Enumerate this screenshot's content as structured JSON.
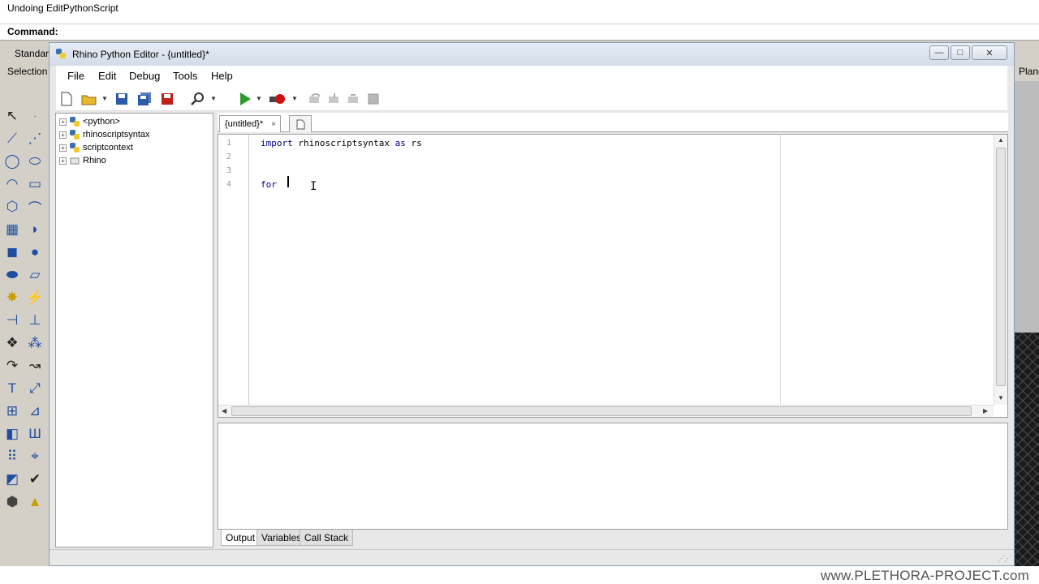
{
  "rhino": {
    "history_text": "Undoing EditPythonScript",
    "command_label": "Command:",
    "tabs_left": [
      "Standard",
      "Selection"
    ],
    "tab_right": "Plane",
    "footer_watermark": "www.PLETHORA-PROJECT.com"
  },
  "editor": {
    "title": "Rhino Python Editor - {untitled}*",
    "window_buttons": {
      "minimize": "—",
      "maximize": "□",
      "close": "✕"
    },
    "menu": [
      "File",
      "Edit",
      "Debug",
      "Tools",
      "Help"
    ],
    "tree": [
      "<python>",
      "rhinoscriptsyntax",
      "scriptcontext",
      "Rhino"
    ],
    "script_tab": {
      "label": "{untitled}*",
      "close": "×"
    },
    "code": {
      "line_numbers": [
        "1",
        "2",
        "3",
        "4"
      ],
      "line1": {
        "kw1": "import",
        "mid": " rhinoscriptsyntax ",
        "kw2": "as",
        "tail": " rs"
      },
      "line4": {
        "kw": "for",
        "tail": " "
      }
    },
    "output_tabs": [
      "Output",
      "Variables",
      "Call Stack"
    ],
    "ibeam_glyph": "I",
    "grip_glyph": "⋰⋰"
  },
  "colors": {
    "keyword": "#00008b",
    "run_green": "#2e9a2e",
    "stop_red": "#cc1111"
  }
}
